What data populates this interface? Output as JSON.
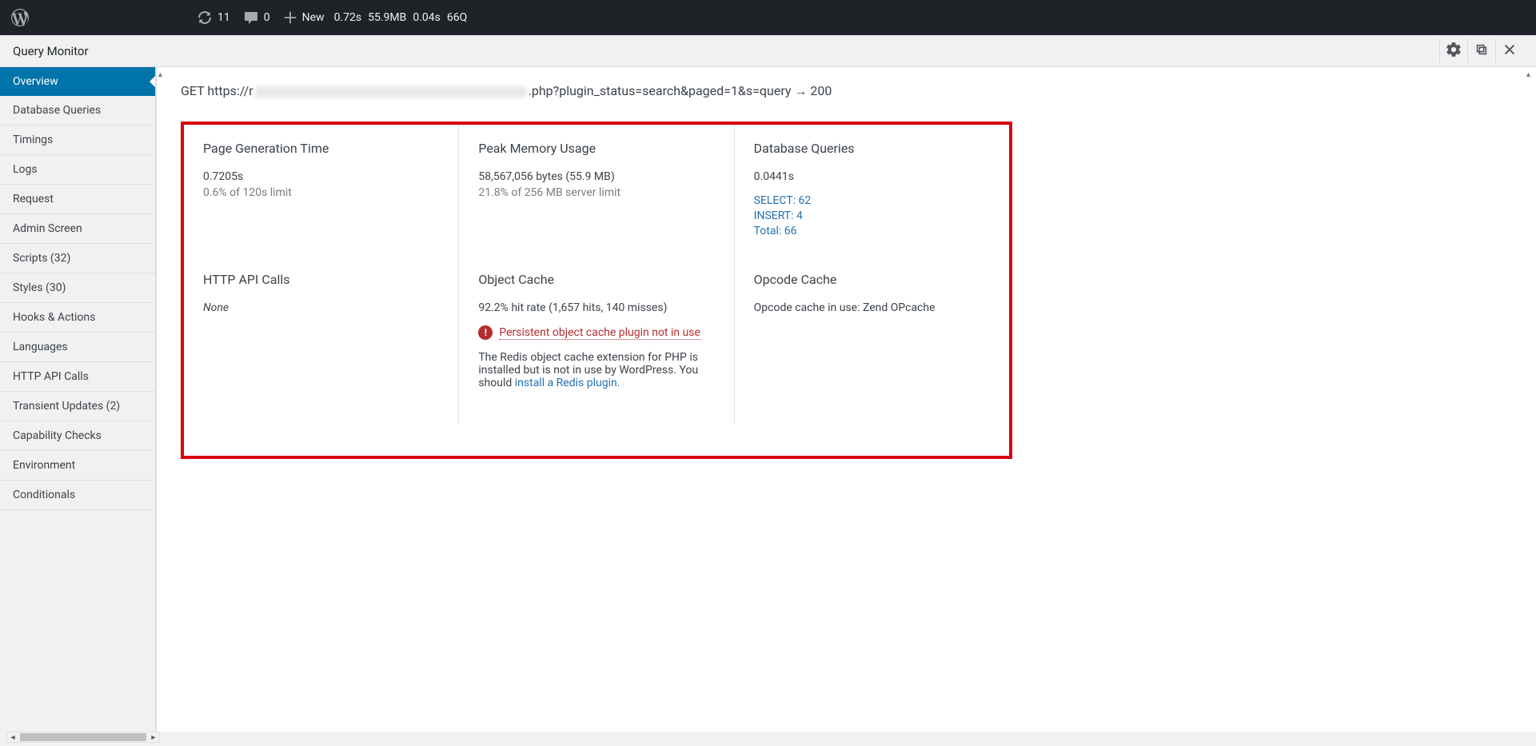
{
  "adminbar": {
    "updates_count": "11",
    "comments_count": "0",
    "new_label": "New",
    "stats_time": "0.72s",
    "stats_memory": "55.9MB",
    "stats_dbtime": "0.04s",
    "stats_queries": "66Q"
  },
  "header": {
    "title": "Query Monitor"
  },
  "sidebar": {
    "items": [
      {
        "label": "Overview",
        "active": true
      },
      {
        "label": "Database Queries"
      },
      {
        "label": "Timings"
      },
      {
        "label": "Logs"
      },
      {
        "label": "Request"
      },
      {
        "label": "Admin Screen"
      },
      {
        "label": "Scripts (32)"
      },
      {
        "label": "Styles (30)"
      },
      {
        "label": "Hooks & Actions"
      },
      {
        "label": "Languages"
      },
      {
        "label": "HTTP API Calls"
      },
      {
        "label": "Transient Updates (2)"
      },
      {
        "label": "Capability Checks"
      },
      {
        "label": "Environment"
      },
      {
        "label": "Conditionals"
      }
    ]
  },
  "request_line": {
    "method": "GET",
    "prefix": "https://r",
    "suffix": ".php?plugin_status=search&paged=1&s=query → 200"
  },
  "overview": {
    "pgt": {
      "title": "Page Generation Time",
      "value": "0.7205s",
      "sub": "0.6% of 120s limit"
    },
    "mem": {
      "title": "Peak Memory Usage",
      "value": "58,567,056 bytes (55.9 MB)",
      "sub": "21.8% of 256 MB server limit"
    },
    "dbq": {
      "title": "Database Queries",
      "value": "0.0441s",
      "link_select": "SELECT: 62",
      "link_insert": "INSERT: 4",
      "link_total": "Total: 66"
    },
    "api": {
      "title": "HTTP API Calls",
      "value": "None"
    },
    "obj": {
      "title": "Object Cache",
      "hit": "92.2% hit rate (1,657 hits, 140 misses)",
      "warn": "Persistent object cache plugin not in use",
      "desc_a": "The Redis object cache extension for PHP is installed but is not in use by WordPress. You should ",
      "desc_link": "install a Redis plugin",
      "desc_b": "."
    },
    "op": {
      "title": "Opcode Cache",
      "value": "Opcode cache in use: Zend OPcache"
    }
  }
}
